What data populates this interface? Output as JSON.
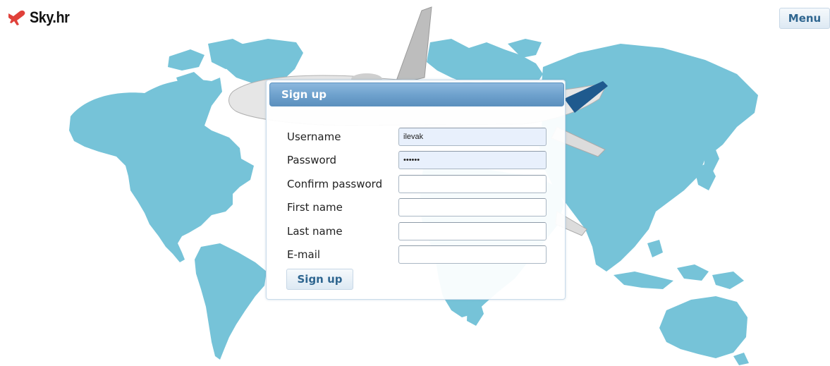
{
  "header": {
    "logo_text": "Sky.hr",
    "logo_icon": "airplane-icon",
    "menu_label": "Menu"
  },
  "dialog": {
    "title": "Sign up",
    "fields": [
      {
        "label": "Username",
        "value": "ilevak",
        "type": "text"
      },
      {
        "label": "Password",
        "value": "••••••",
        "type": "password"
      },
      {
        "label": "Confirm password",
        "value": "",
        "type": "password"
      },
      {
        "label": "First name",
        "value": "",
        "type": "text"
      },
      {
        "label": "Last name",
        "value": "",
        "type": "text"
      },
      {
        "label": "E-mail",
        "value": "",
        "type": "text"
      }
    ],
    "submit_label": "Sign up"
  },
  "colors": {
    "map": "#76c3d8",
    "header_blue": "#6da0cc",
    "button_text": "#2f6690",
    "logo_red": "#e0413a"
  },
  "background": {
    "image": "world-map-with-airplane"
  }
}
